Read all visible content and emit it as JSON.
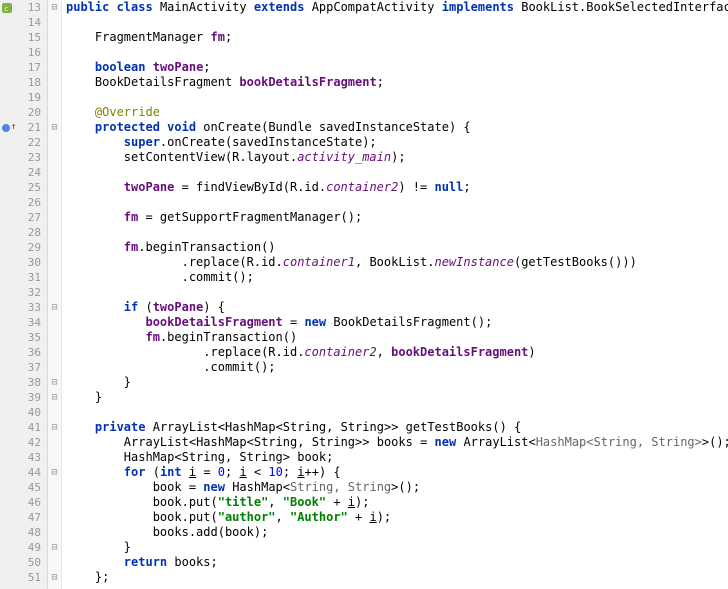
{
  "lines": [
    {
      "n": 13,
      "icons": [
        "class"
      ],
      "fold": "⊟",
      "html": "<span class='kw'>public class</span> <span class='typ'>MainActivity</span> <span class='kw'>extends</span> <span class='typ'>AppCompatActivity</span> <span class='kw'>implements</span> <span class='typ'>BookList.BookSelectedInterface</span> {"
    },
    {
      "n": 14,
      "html": ""
    },
    {
      "n": 15,
      "html": "    <span class='typ'>FragmentManager</span> <span class='fld'>fm</span>;"
    },
    {
      "n": 16,
      "html": ""
    },
    {
      "n": 17,
      "html": "    <span class='kw'>boolean</span> <span class='fld'>twoPane</span>;"
    },
    {
      "n": 18,
      "html": "    <span class='typ'>BookDetailsFragment</span> <span class='fld'>bookDetailsFragment</span>;"
    },
    {
      "n": 19,
      "html": ""
    },
    {
      "n": 20,
      "html": "    <span class='ann'>@Override</span>"
    },
    {
      "n": 21,
      "icons": [
        "override",
        "up"
      ],
      "fold": "⊟",
      "html": "    <span class='kw'>protected void</span> <span class='mtd'>onCreate</span>(<span class='typ'>Bundle</span> savedInstanceState) {"
    },
    {
      "n": 22,
      "html": "        <span class='kw'>super</span>.onCreate(savedInstanceState);"
    },
    {
      "n": 23,
      "html": "        setContentView(R.layout.<span class='sfld'>activity_main</span>);"
    },
    {
      "n": 24,
      "html": ""
    },
    {
      "n": 25,
      "html": "        <span class='fld'>twoPane</span> = findViewById(R.id.<span class='sfld'>container2</span>) != <span class='kw'>null</span>;"
    },
    {
      "n": 26,
      "html": ""
    },
    {
      "n": 27,
      "html": "        <span class='fld'>fm</span> = getSupportFragmentManager();"
    },
    {
      "n": 28,
      "html": ""
    },
    {
      "n": 29,
      "html": "        <span class='fld'>fm</span>.beginTransaction()"
    },
    {
      "n": 30,
      "html": "                .replace(R.id.<span class='sfld'>container1</span>, BookList.<span class='sfld'>newInstance</span>(getTestBooks()))"
    },
    {
      "n": 31,
      "html": "                .commit();"
    },
    {
      "n": 32,
      "html": ""
    },
    {
      "n": 33,
      "fold": "⊟",
      "html": "        <span class='kw'>if</span> (<span class='fld'>twoPane</span>) {"
    },
    {
      "n": 34,
      "html": "           <span class='fld'>bookDetailsFragment</span> = <span class='kw'>new</span> BookDetailsFragment();"
    },
    {
      "n": 35,
      "html": "           <span class='fld'>fm</span>.beginTransaction()"
    },
    {
      "n": 36,
      "html": "                   .replace(R.id.<span class='sfld'>container2</span>, <span class='fld'>bookDetailsFragment</span>)"
    },
    {
      "n": 37,
      "html": "                   .commit();"
    },
    {
      "n": 38,
      "fold": "⊟",
      "html": "        }"
    },
    {
      "n": 39,
      "fold": "⊟",
      "html": "    }"
    },
    {
      "n": 40,
      "html": ""
    },
    {
      "n": 41,
      "fold": "⊟",
      "html": "    <span class='kw'>private</span> <span class='typ'>ArrayList</span>&lt;<span class='typ'>HashMap</span>&lt;<span class='typ'>String</span>, <span class='typ'>String</span>&gt;&gt; <span class='mtd'>getTestBooks</span>() {"
    },
    {
      "n": 42,
      "html": "        <span class='typ'>ArrayList</span>&lt;<span class='typ'>HashMap</span>&lt;<span class='typ'>String</span>, <span class='typ'>String</span>&gt;&gt; books = <span class='kw'>new</span> ArrayList&lt;<span class='gen'>HashMap&lt;String, String&gt;</span>&gt;();"
    },
    {
      "n": 43,
      "html": "        <span class='typ'>HashMap</span>&lt;<span class='typ'>String</span>, <span class='typ'>String</span>&gt; book;"
    },
    {
      "n": 44,
      "fold": "⊟",
      "html": "        <span class='kw'>for</span> (<span class='kw'>int</span> <span class='pln'><u>i</u></span> = <span class='num'>0</span>; <span class='pln'><u>i</u></span> &lt; <span class='num'>10</span>; <span class='pln'><u>i</u></span>++) {"
    },
    {
      "n": 45,
      "html": "            book = <span class='kw'>new</span> HashMap&lt;<span class='gen'>String, String</span>&gt;();"
    },
    {
      "n": 46,
      "html": "            book.put(<span class='str'>\"title\"</span>, <span class='str'>\"Book\"</span> + <span class='pln'><u>i</u></span>);"
    },
    {
      "n": 47,
      "html": "            book.put(<span class='str'>\"author\"</span>, <span class='str'>\"Author\"</span> + <span class='pln'><u>i</u></span>);"
    },
    {
      "n": 48,
      "html": "            books.add(book);"
    },
    {
      "n": 49,
      "fold": "⊟",
      "html": "        }"
    },
    {
      "n": 50,
      "html": "        <span class='kw'>return</span> books;"
    },
    {
      "n": 51,
      "fold": "⊟",
      "html": "    };"
    }
  ]
}
